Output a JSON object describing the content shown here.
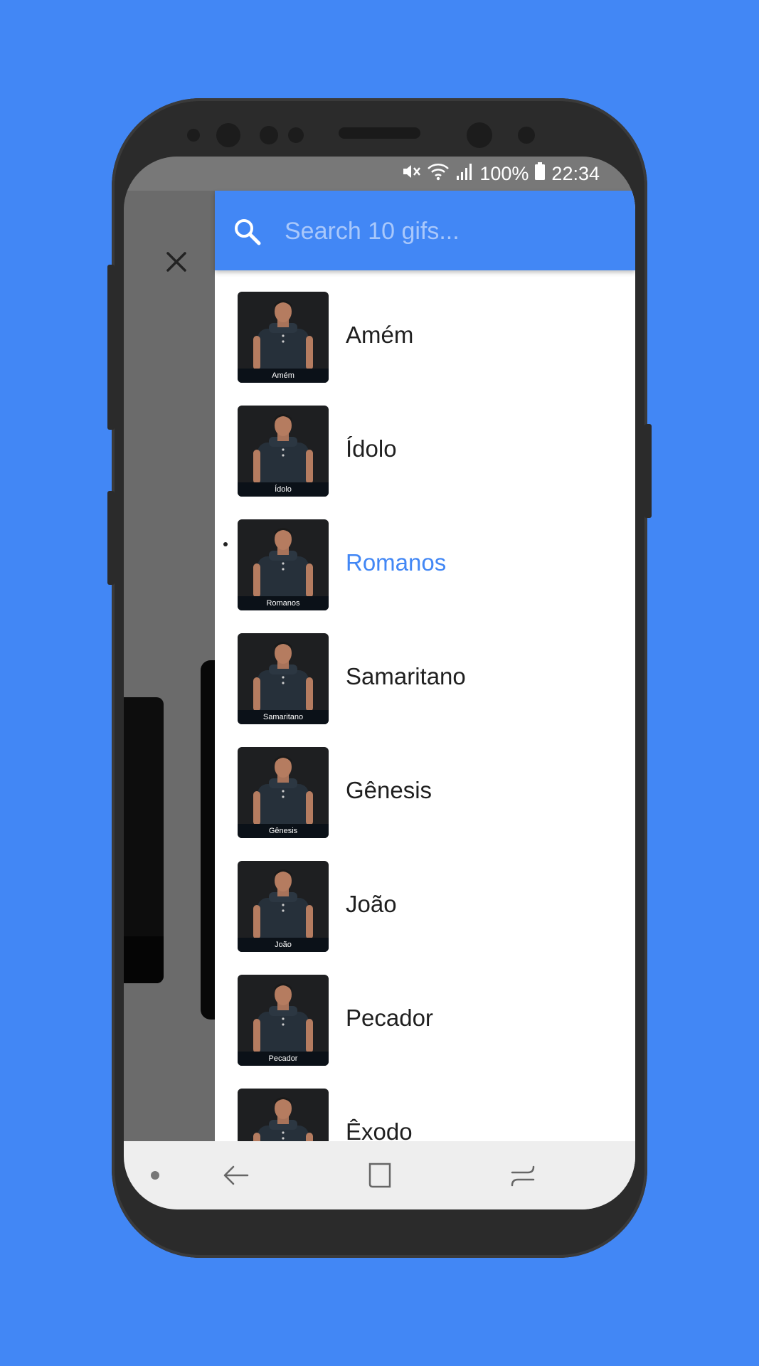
{
  "status_bar": {
    "battery_percent": "100%",
    "time": "22:34",
    "icons": [
      "mute-icon",
      "wifi-icon",
      "signal-icon",
      "battery-icon"
    ]
  },
  "search": {
    "placeholder": "Search 10 gifs...",
    "value": ""
  },
  "close_icon": "close-icon",
  "list": {
    "selected_index": 2,
    "items": [
      {
        "label": "Amém",
        "caption": "Amém"
      },
      {
        "label": "Ídolo",
        "caption": "Ídolo"
      },
      {
        "label": "Romanos",
        "caption": "Romanos"
      },
      {
        "label": "Samaritano",
        "caption": "Samaritano"
      },
      {
        "label": "Gênesis",
        "caption": "Gênesis"
      },
      {
        "label": "João",
        "caption": "João"
      },
      {
        "label": "Pecador",
        "caption": "Pecador"
      },
      {
        "label": "Êxodo",
        "caption": ""
      }
    ]
  },
  "nav_bar": {
    "buttons": [
      "back-icon",
      "home-icon",
      "recents-icon"
    ]
  },
  "colors": {
    "background": "#4287f5",
    "accent": "#4287f5",
    "search_placeholder": "#a9c8fb",
    "item_text": "#1f1f1f"
  }
}
